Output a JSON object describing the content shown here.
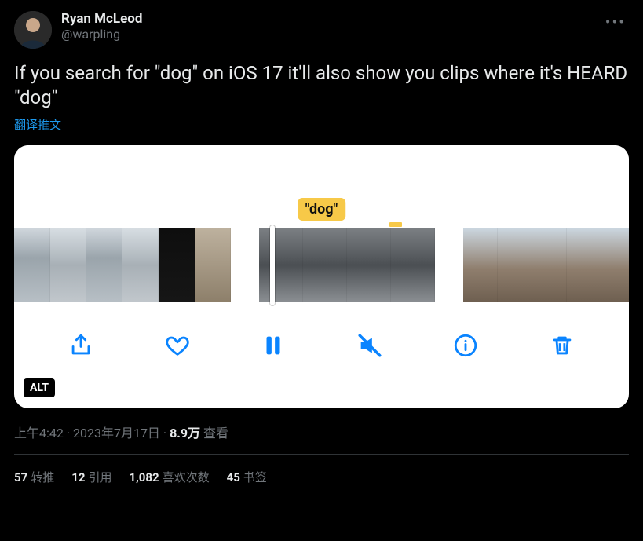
{
  "author": {
    "display_name": "Ryan McLeod",
    "handle": "@warpling"
  },
  "more_label": "•••",
  "body": "If you search for \"dog\" on iOS 17 it'll also show you clips where it's HEARD \"dog\"",
  "translate_label": "翻译推文",
  "media": {
    "caption_marker": "\"dog\"",
    "alt_badge": "ALT",
    "controls": {
      "share": "share-icon",
      "like": "heart-icon",
      "pause": "pause-icon",
      "mute": "speaker-muted-icon",
      "info": "info-icon",
      "trash": "trash-icon"
    }
  },
  "meta": {
    "time": "上午4:42",
    "sep1": " · ",
    "date": "2023年7月17日",
    "sep2": " · ",
    "views_count": "8.9万",
    "views_label": " 查看"
  },
  "stats": {
    "retweets_n": "57",
    "retweets_l": "转推",
    "quotes_n": "12",
    "quotes_l": "引用",
    "likes_n": "1,082",
    "likes_l": "喜欢次数",
    "bookmarks_n": "45",
    "bookmarks_l": "书签"
  }
}
